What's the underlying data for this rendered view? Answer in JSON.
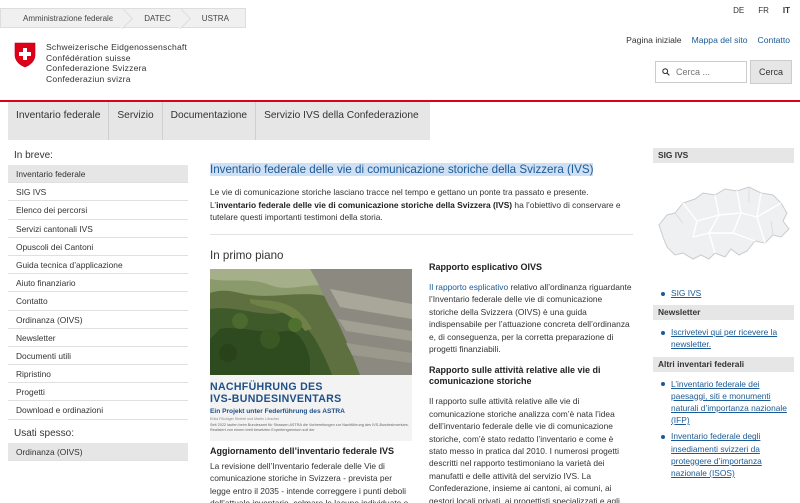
{
  "breadcrumb": [
    "Amministrazione federale",
    "DATEC",
    "USTRA"
  ],
  "languages": [
    {
      "code": "DE",
      "active": false
    },
    {
      "code": "FR",
      "active": false
    },
    {
      "code": "IT",
      "active": true
    }
  ],
  "logo": {
    "lines": [
      "Schweizerische Eidgenossenschaft",
      "Confédération suisse",
      "Confederazione Svizzera",
      "Confederaziun svizra"
    ]
  },
  "service_nav": [
    "Pagina iniziale",
    "Mappa del sito",
    "Contatto"
  ],
  "search": {
    "placeholder": "Cerca ...",
    "button": "Cerca"
  },
  "main_nav": [
    "Inventario federale",
    "Servizio",
    "Documentazione",
    "Servizio IVS della Confederazione"
  ],
  "sidebar": {
    "breve_title": "In breve:",
    "breve_items": [
      "Inventario federale",
      "SIG IVS",
      "Elenco dei percorsi",
      "Servizi cantonali IVS",
      "Opuscoli dei Cantoni",
      "Guida tecnica d’applicazione",
      "Aiuto finanziario",
      "Contatto",
      "Ordinanza (OIVS)",
      "Newsletter",
      "Documenti utili",
      "Ripristino",
      "Progetti",
      "Download e ordinazioni"
    ],
    "spesso_title": "Usati spesso:",
    "spesso_items": [
      "Ordinanza (OIVS)"
    ]
  },
  "content": {
    "title": "Inventario federale delle vie di comunicazione storiche della Svizzera (IVS)",
    "intro_1": "Le vie di comunicazione storiche lasciano tracce nel tempo e gettano un ponte tra passato e presente.",
    "intro_2_pre": "L’",
    "intro_2_bold": "inventario federale delle vie di comunicazione storiche della Svizzera (IVS)",
    "intro_2_post": " ha l’obiettivo di conservare e tutelare questi importanti testimoni della storia.",
    "primo_piano": "In primo piano",
    "doc": {
      "h1a": "NACHFÜHRUNG DES",
      "h1b": "IVS-BUNDESINVENTARS",
      "h2": "Ein Projekt unter Federführung des ASTRA",
      "small": "Erika Flückiger Strebel und Martin Lörscher",
      "text": "Seit 2022 laufen beim Bundesamt für Strassen ASTRA die Vorbereitungen zur Nachführung des IVS-Bundesinventars. Realisiert von einem breit besetzten Expertengremium soll der"
    },
    "aggiornamento_title": "Aggiornamento dell’inventario federale IVS",
    "aggiornamento_text": "La revisione dell’Inventario federale delle Vie di comunicazione storiche in Svizzera - prevista per legge entro il 2035 - intende correggere i punti deboli dell’attuale inventario, colmare le lacune individuate e",
    "rapporto1_title": "Rapporto esplicativo OIVS",
    "rapporto1_link": "Il rapporto esplicativo",
    "rapporto1_text": " relativo all’ordinanza riguardante l’Inventario federale delle vie di comunicazione storiche della Svizzera (OIVS) è una guida indispensabile per l’attuazione concreta dell’ordinanza e, di conseguenza, per la corretta preparazione di progetti finanziabili.",
    "rapporto2_title": "Rapporto sulle attività relative alle vie di comunicazione storiche",
    "rapporto2_text": "Il rapporto sulle attività relative alle vie di comunicazione storiche analizza com’è nata l’idea dell’inventario federale delle vie di comunicazione storiche, com’è stato redatto l’inventario e come è stato messo in pratica dal 2010. I numerosi progetti descritti nel rapporto testimoniano la varietà dei manufatti e delle attività del servizio IVS. La Confederazione, insieme ai cantoni, ai comuni, ai gestori locali privati, ai progettisti specializzati e agli esecutori presta un importante contributo alla tutela e"
  },
  "rightbar": {
    "sig_title": "SIG IVS",
    "sig_link": "SIG IVS",
    "newsletter_title": "Newsletter",
    "newsletter_link": "Iscrivetevi qui per ricevere la newsletter.",
    "altri_title": "Altri inventari federali",
    "altri_links": [
      "L’inventario federale dei paesaggi, siti e monumenti naturali d’importanza nazionale (IFP)",
      "Inventario federale degli insediamenti svizzeri da proteggere d’importanza nazionale (ISOS)"
    ]
  },
  "colors": {
    "accent_red": "#dc0018",
    "link_blue": "#1a5a96",
    "nav_gray": "#e6e6e6"
  }
}
